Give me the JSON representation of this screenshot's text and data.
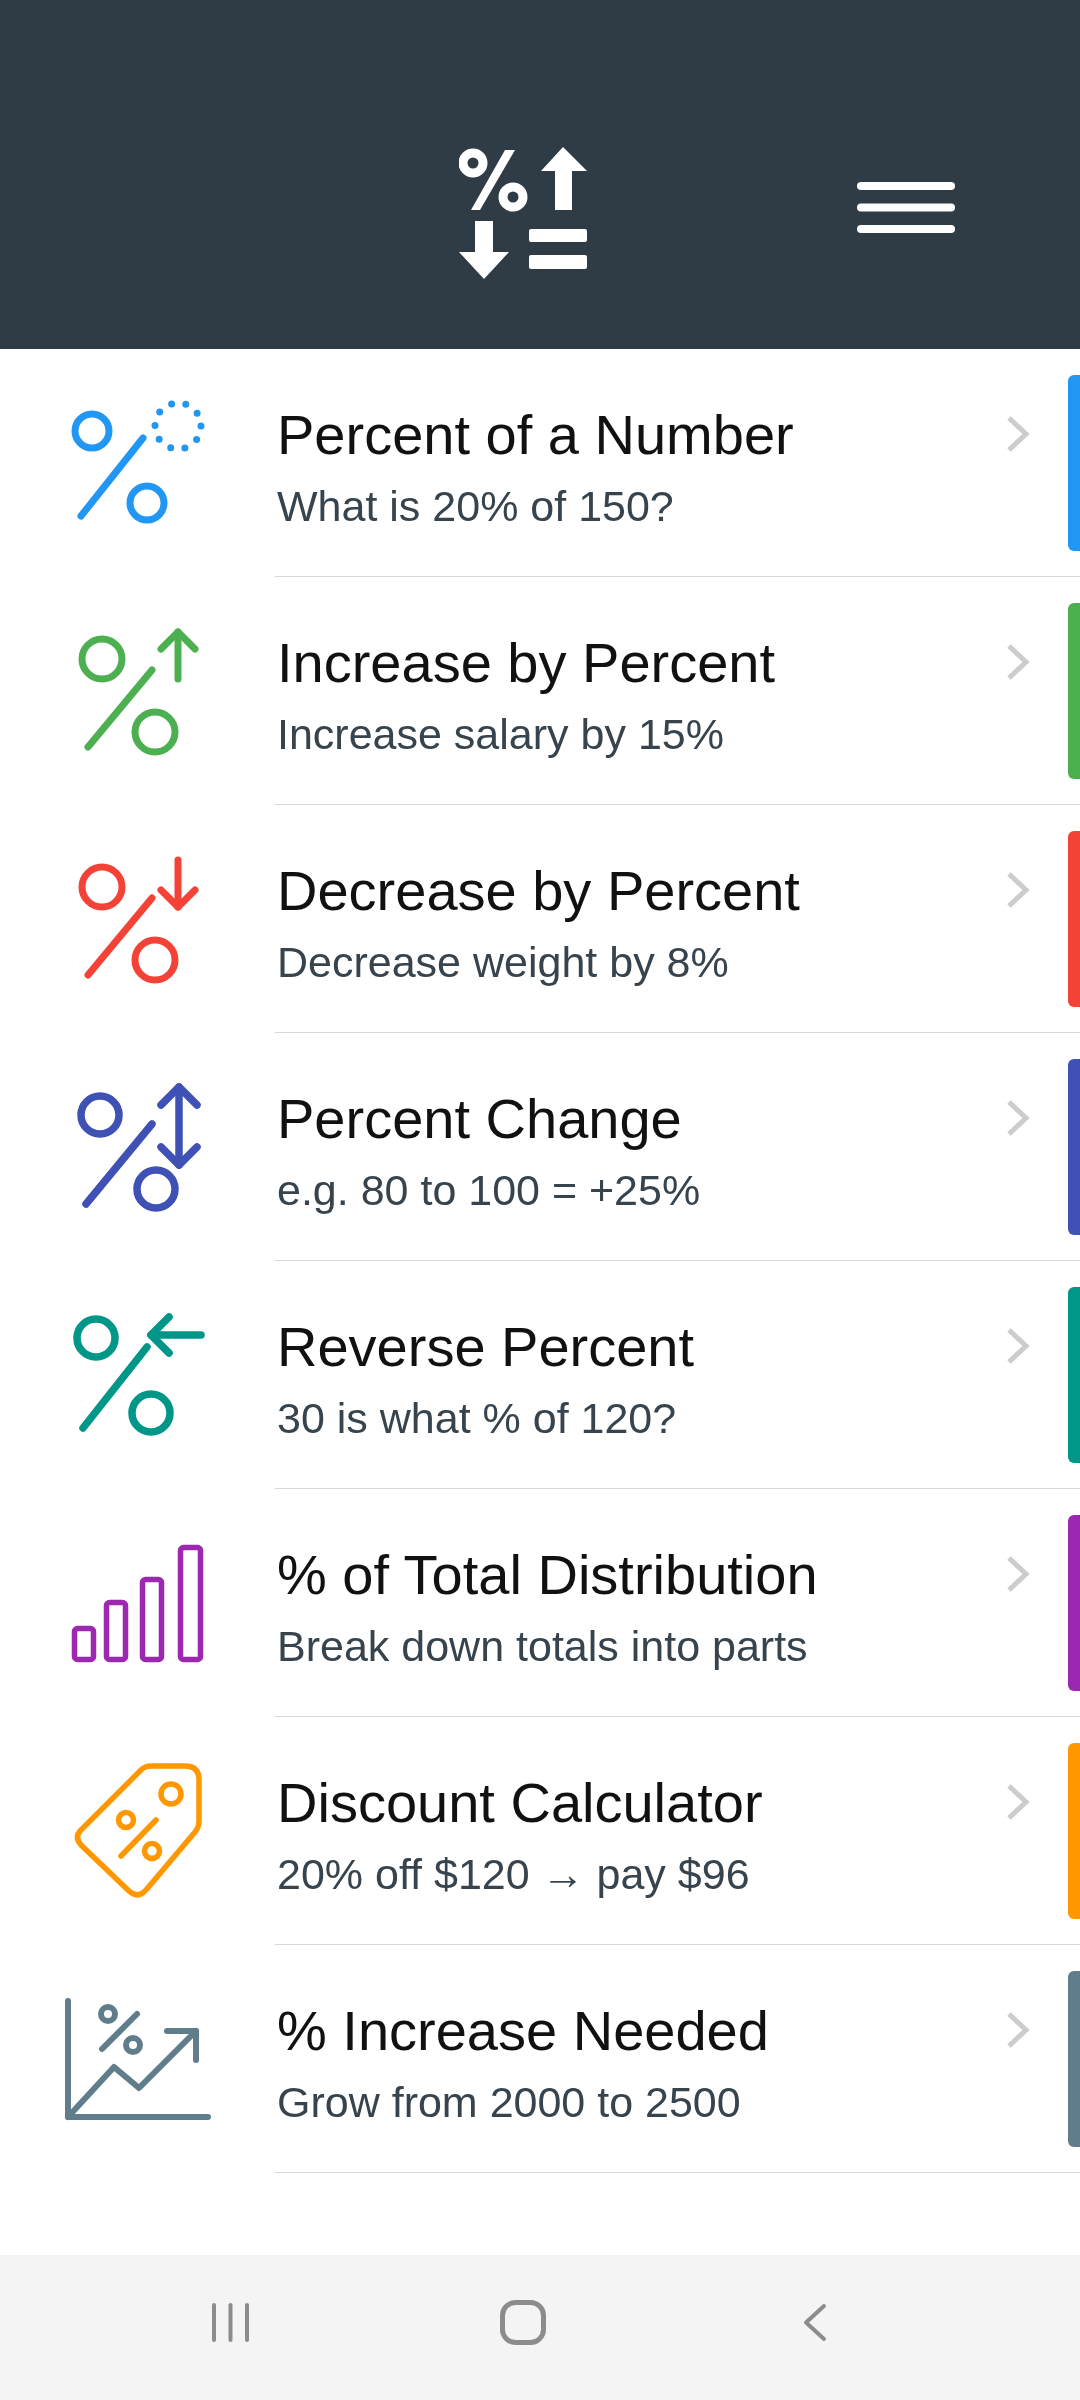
{
  "calculators": [
    {
      "title": "Percent of a Number",
      "subtitle": "What is 20% of 150?",
      "color": "#2196f3"
    },
    {
      "title": "Increase by Percent",
      "subtitle": "Increase salary by 15%",
      "color": "#4caf50"
    },
    {
      "title": "Decrease by Percent",
      "subtitle": "Decrease weight by 8%",
      "color": "#f44336"
    },
    {
      "title": "Percent Change",
      "subtitle": "e.g. 80 to 100 = +25%",
      "color": "#3f51b5"
    },
    {
      "title": "Reverse Percent",
      "subtitle": "30 is what % of 120?",
      "color": "#009688"
    },
    {
      "title": "% of Total Distribution",
      "subtitle": "Break down totals into parts",
      "color": "#9c27b0"
    },
    {
      "title": "Discount Calculator",
      "subtitle": "20% off $120 → pay $96",
      "color": "#ff9800"
    },
    {
      "title": "% Increase Needed",
      "subtitle": "Grow from 2000 to 2500",
      "color": "#607d8b"
    }
  ]
}
